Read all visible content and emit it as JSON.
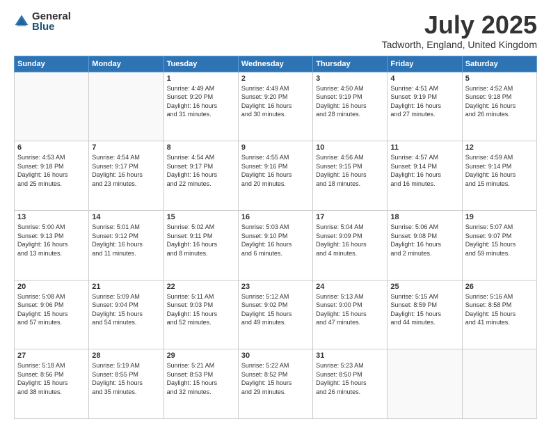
{
  "logo": {
    "general": "General",
    "blue": "Blue"
  },
  "title": {
    "month": "July 2025",
    "location": "Tadworth, England, United Kingdom"
  },
  "header_days": [
    "Sunday",
    "Monday",
    "Tuesday",
    "Wednesday",
    "Thursday",
    "Friday",
    "Saturday"
  ],
  "weeks": [
    [
      {
        "day": "",
        "info": ""
      },
      {
        "day": "",
        "info": ""
      },
      {
        "day": "1",
        "info": "Sunrise: 4:49 AM\nSunset: 9:20 PM\nDaylight: 16 hours\nand 31 minutes."
      },
      {
        "day": "2",
        "info": "Sunrise: 4:49 AM\nSunset: 9:20 PM\nDaylight: 16 hours\nand 30 minutes."
      },
      {
        "day": "3",
        "info": "Sunrise: 4:50 AM\nSunset: 9:19 PM\nDaylight: 16 hours\nand 28 minutes."
      },
      {
        "day": "4",
        "info": "Sunrise: 4:51 AM\nSunset: 9:19 PM\nDaylight: 16 hours\nand 27 minutes."
      },
      {
        "day": "5",
        "info": "Sunrise: 4:52 AM\nSunset: 9:18 PM\nDaylight: 16 hours\nand 26 minutes."
      }
    ],
    [
      {
        "day": "6",
        "info": "Sunrise: 4:53 AM\nSunset: 9:18 PM\nDaylight: 16 hours\nand 25 minutes."
      },
      {
        "day": "7",
        "info": "Sunrise: 4:54 AM\nSunset: 9:17 PM\nDaylight: 16 hours\nand 23 minutes."
      },
      {
        "day": "8",
        "info": "Sunrise: 4:54 AM\nSunset: 9:17 PM\nDaylight: 16 hours\nand 22 minutes."
      },
      {
        "day": "9",
        "info": "Sunrise: 4:55 AM\nSunset: 9:16 PM\nDaylight: 16 hours\nand 20 minutes."
      },
      {
        "day": "10",
        "info": "Sunrise: 4:56 AM\nSunset: 9:15 PM\nDaylight: 16 hours\nand 18 minutes."
      },
      {
        "day": "11",
        "info": "Sunrise: 4:57 AM\nSunset: 9:14 PM\nDaylight: 16 hours\nand 16 minutes."
      },
      {
        "day": "12",
        "info": "Sunrise: 4:59 AM\nSunset: 9:14 PM\nDaylight: 16 hours\nand 15 minutes."
      }
    ],
    [
      {
        "day": "13",
        "info": "Sunrise: 5:00 AM\nSunset: 9:13 PM\nDaylight: 16 hours\nand 13 minutes."
      },
      {
        "day": "14",
        "info": "Sunrise: 5:01 AM\nSunset: 9:12 PM\nDaylight: 16 hours\nand 11 minutes."
      },
      {
        "day": "15",
        "info": "Sunrise: 5:02 AM\nSunset: 9:11 PM\nDaylight: 16 hours\nand 8 minutes."
      },
      {
        "day": "16",
        "info": "Sunrise: 5:03 AM\nSunset: 9:10 PM\nDaylight: 16 hours\nand 6 minutes."
      },
      {
        "day": "17",
        "info": "Sunrise: 5:04 AM\nSunset: 9:09 PM\nDaylight: 16 hours\nand 4 minutes."
      },
      {
        "day": "18",
        "info": "Sunrise: 5:06 AM\nSunset: 9:08 PM\nDaylight: 16 hours\nand 2 minutes."
      },
      {
        "day": "19",
        "info": "Sunrise: 5:07 AM\nSunset: 9:07 PM\nDaylight: 15 hours\nand 59 minutes."
      }
    ],
    [
      {
        "day": "20",
        "info": "Sunrise: 5:08 AM\nSunset: 9:06 PM\nDaylight: 15 hours\nand 57 minutes."
      },
      {
        "day": "21",
        "info": "Sunrise: 5:09 AM\nSunset: 9:04 PM\nDaylight: 15 hours\nand 54 minutes."
      },
      {
        "day": "22",
        "info": "Sunrise: 5:11 AM\nSunset: 9:03 PM\nDaylight: 15 hours\nand 52 minutes."
      },
      {
        "day": "23",
        "info": "Sunrise: 5:12 AM\nSunset: 9:02 PM\nDaylight: 15 hours\nand 49 minutes."
      },
      {
        "day": "24",
        "info": "Sunrise: 5:13 AM\nSunset: 9:00 PM\nDaylight: 15 hours\nand 47 minutes."
      },
      {
        "day": "25",
        "info": "Sunrise: 5:15 AM\nSunset: 8:59 PM\nDaylight: 15 hours\nand 44 minutes."
      },
      {
        "day": "26",
        "info": "Sunrise: 5:16 AM\nSunset: 8:58 PM\nDaylight: 15 hours\nand 41 minutes."
      }
    ],
    [
      {
        "day": "27",
        "info": "Sunrise: 5:18 AM\nSunset: 8:56 PM\nDaylight: 15 hours\nand 38 minutes."
      },
      {
        "day": "28",
        "info": "Sunrise: 5:19 AM\nSunset: 8:55 PM\nDaylight: 15 hours\nand 35 minutes."
      },
      {
        "day": "29",
        "info": "Sunrise: 5:21 AM\nSunset: 8:53 PM\nDaylight: 15 hours\nand 32 minutes."
      },
      {
        "day": "30",
        "info": "Sunrise: 5:22 AM\nSunset: 8:52 PM\nDaylight: 15 hours\nand 29 minutes."
      },
      {
        "day": "31",
        "info": "Sunrise: 5:23 AM\nSunset: 8:50 PM\nDaylight: 15 hours\nand 26 minutes."
      },
      {
        "day": "",
        "info": ""
      },
      {
        "day": "",
        "info": ""
      }
    ]
  ]
}
